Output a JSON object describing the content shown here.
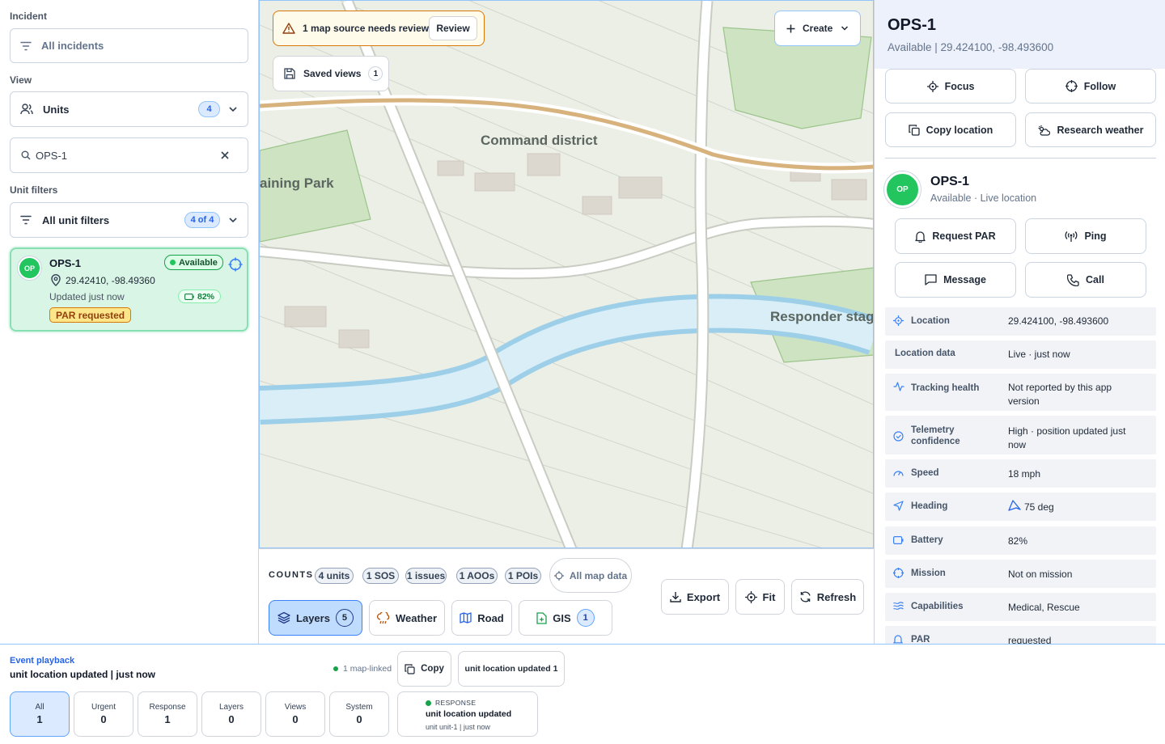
{
  "left": {
    "incident_label": "Incident",
    "incident_value": "All incidents",
    "view_label": "View",
    "view_value": "Units",
    "view_count": "4",
    "search_value": "OPS-1",
    "unit_filters_label": "Unit filters",
    "unit_filters_value": "All unit filters",
    "unit_filters_count": "4 of 4",
    "unit": {
      "initials": "OP",
      "name": "OPS-1",
      "status": "Available",
      "coords": "29.42410, -98.49360",
      "updated": "Updated just now",
      "battery": "82%",
      "par": "PAR requested"
    }
  },
  "map": {
    "alert_text": "1 map source needs review",
    "review_label": "Review",
    "saved_views_label": "Saved views",
    "saved_views_count": "1",
    "create_label": "Create",
    "labels": {
      "command": "Command district",
      "training": "aining Park",
      "responder": "Responder stag"
    }
  },
  "counts": {
    "title": "COUNTS",
    "chips": [
      "4 units",
      "1 SOS",
      "1 issues",
      "1 AOOs",
      "1 POIs"
    ],
    "all_map_data": "All map data",
    "export": "Export",
    "fit": "Fit",
    "refresh": "Refresh",
    "layers": "Layers",
    "layers_count": "5",
    "weather": "Weather",
    "road": "Road",
    "gis": "GIS",
    "gis_count": "1"
  },
  "right": {
    "title": "OPS-1",
    "subtitle": "Available | 29.424100, -98.493600",
    "focus": "Focus",
    "follow": "Follow",
    "copy_location": "Copy location",
    "research_weather": "Research weather",
    "unit_initials": "OP",
    "unit_name": "OPS-1",
    "unit_status": "Available · Live location",
    "request_par": "Request PAR",
    "ping": "Ping",
    "message": "Message",
    "call": "Call",
    "details": [
      {
        "label": "Location",
        "value": "29.424100, -98.493600",
        "icon": "target-icon"
      },
      {
        "label": "Location data",
        "value": "Live · just now",
        "icon": ""
      },
      {
        "label": "Tracking health",
        "value": "Not reported by this app version",
        "icon": "activity-icon"
      },
      {
        "label": "Telemetry confidence",
        "value": "High · position updated just now",
        "icon": "check-circle-icon"
      },
      {
        "label": "Speed",
        "value": "18 mph",
        "icon": "gauge-icon"
      },
      {
        "label": "Heading",
        "value": "75 deg",
        "icon": "navigation-icon"
      },
      {
        "label": "Battery",
        "value": "82%",
        "icon": "battery-icon"
      },
      {
        "label": "Mission",
        "value": "Not on mission",
        "icon": "crosshair-icon"
      },
      {
        "label": "Capabilities",
        "value": "Medical, Rescue",
        "icon": "waves-icon"
      },
      {
        "label": "PAR",
        "value": "requested",
        "icon": "bell-icon"
      }
    ]
  },
  "bottom": {
    "title": "Event playback",
    "status": "unit location updated | just now",
    "map_linked": "1 map-linked",
    "copy": "Copy",
    "latest": "unit location updated 1",
    "filters": [
      {
        "label": "All",
        "value": "1"
      },
      {
        "label": "Urgent",
        "value": "0"
      },
      {
        "label": "Response",
        "value": "1"
      },
      {
        "label": "Layers",
        "value": "0"
      },
      {
        "label": "Views",
        "value": "0"
      },
      {
        "label": "System",
        "value": "0"
      }
    ],
    "event": {
      "type": "RESPONSE",
      "title": "unit location updated",
      "meta": "unit unit-1 | just now"
    }
  }
}
